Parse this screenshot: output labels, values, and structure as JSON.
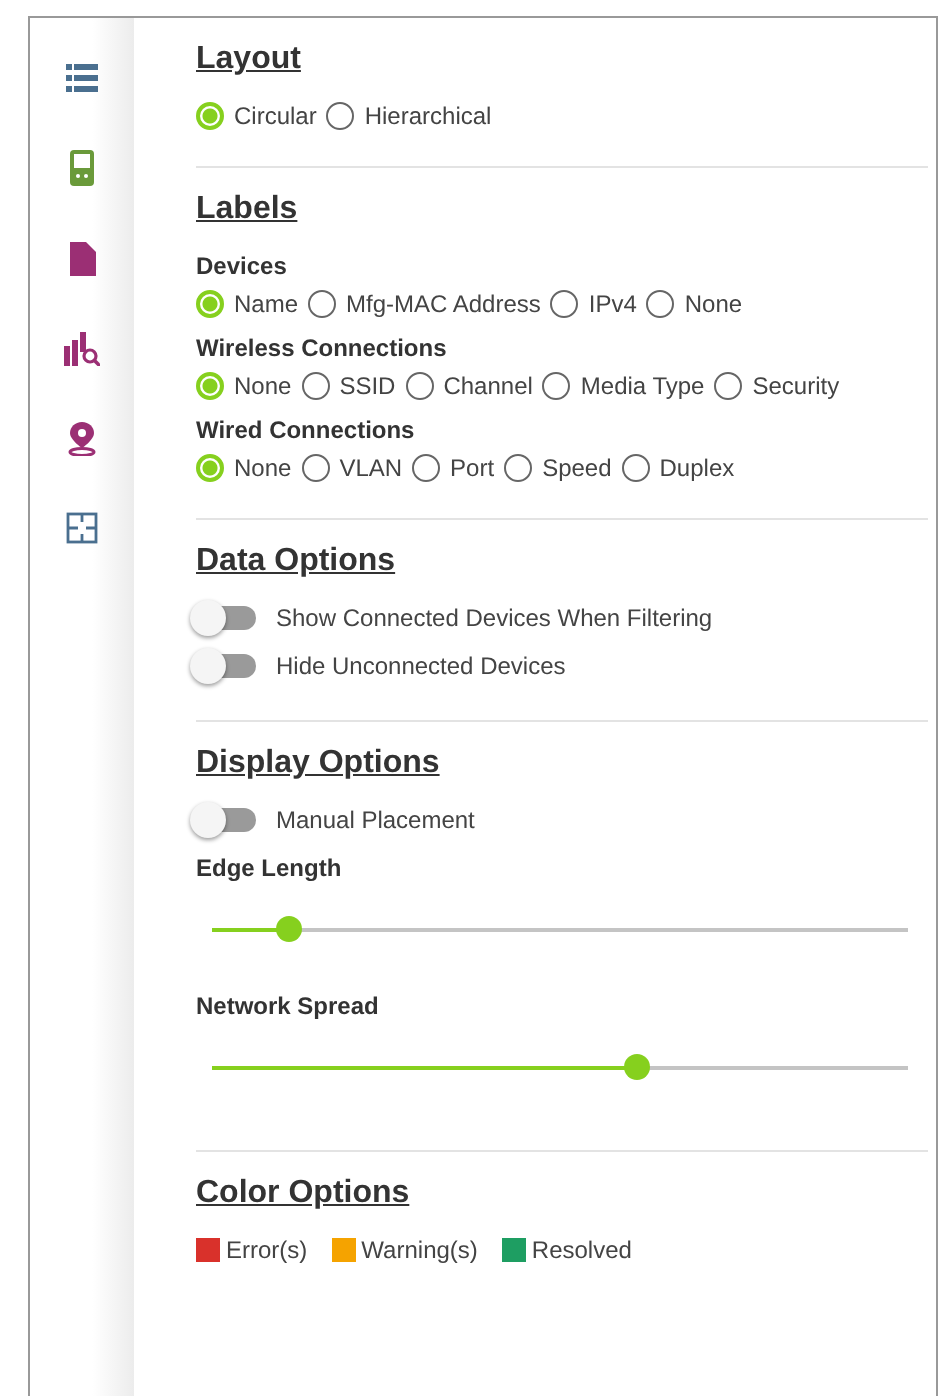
{
  "sections": [
    {
      "title": "Layout",
      "items": [
        {
          "kind": "radios",
          "options": [
            {
              "label": "Circular",
              "selected": true
            },
            {
              "label": "Hierarchical",
              "selected": false
            }
          ]
        }
      ]
    },
    {
      "title": "Labels",
      "items": [
        {
          "kind": "radios",
          "label": "Devices",
          "options": [
            {
              "label": "Name",
              "selected": true
            },
            {
              "label": "Mfg-MAC Address",
              "selected": false
            },
            {
              "label": "IPv4",
              "selected": false
            },
            {
              "label": "None",
              "selected": false
            }
          ]
        },
        {
          "kind": "radios",
          "label": "Wireless Connections",
          "options": [
            {
              "label": "None",
              "selected": true
            },
            {
              "label": "SSID",
              "selected": false
            },
            {
              "label": "Channel",
              "selected": false
            },
            {
              "label": "Media Type",
              "selected": false
            },
            {
              "label": "Security",
              "selected": false
            }
          ]
        },
        {
          "kind": "radios",
          "label": "Wired Connections",
          "options": [
            {
              "label": "None",
              "selected": true
            },
            {
              "label": "VLAN",
              "selected": false
            },
            {
              "label": "Port",
              "selected": false
            },
            {
              "label": "Speed",
              "selected": false
            },
            {
              "label": "Duplex",
              "selected": false
            }
          ]
        }
      ]
    },
    {
      "title": "Data Options",
      "items": [
        {
          "kind": "toggle",
          "label": "Show Connected Devices When Filtering",
          "on": false
        },
        {
          "kind": "toggle",
          "label": "Hide Unconnected Devices",
          "on": false
        }
      ]
    },
    {
      "title": "Display Options",
      "items": [
        {
          "kind": "toggle",
          "label": "Manual Placement",
          "on": false
        },
        {
          "kind": "slider",
          "label": "Edge Length",
          "level": 0.11
        },
        {
          "kind": "slider",
          "label": "Network Spread",
          "level": 0.61
        }
      ]
    },
    {
      "title": "Color Options",
      "items": [
        {
          "kind": "legend",
          "entries": [
            {
              "label": "Error(s)",
              "color": "#d9312b"
            },
            {
              "label": "Warning(s)",
              "color": "#f5a300"
            },
            {
              "label": "Resolved",
              "color": "#1e9e62"
            }
          ]
        }
      ]
    }
  ]
}
